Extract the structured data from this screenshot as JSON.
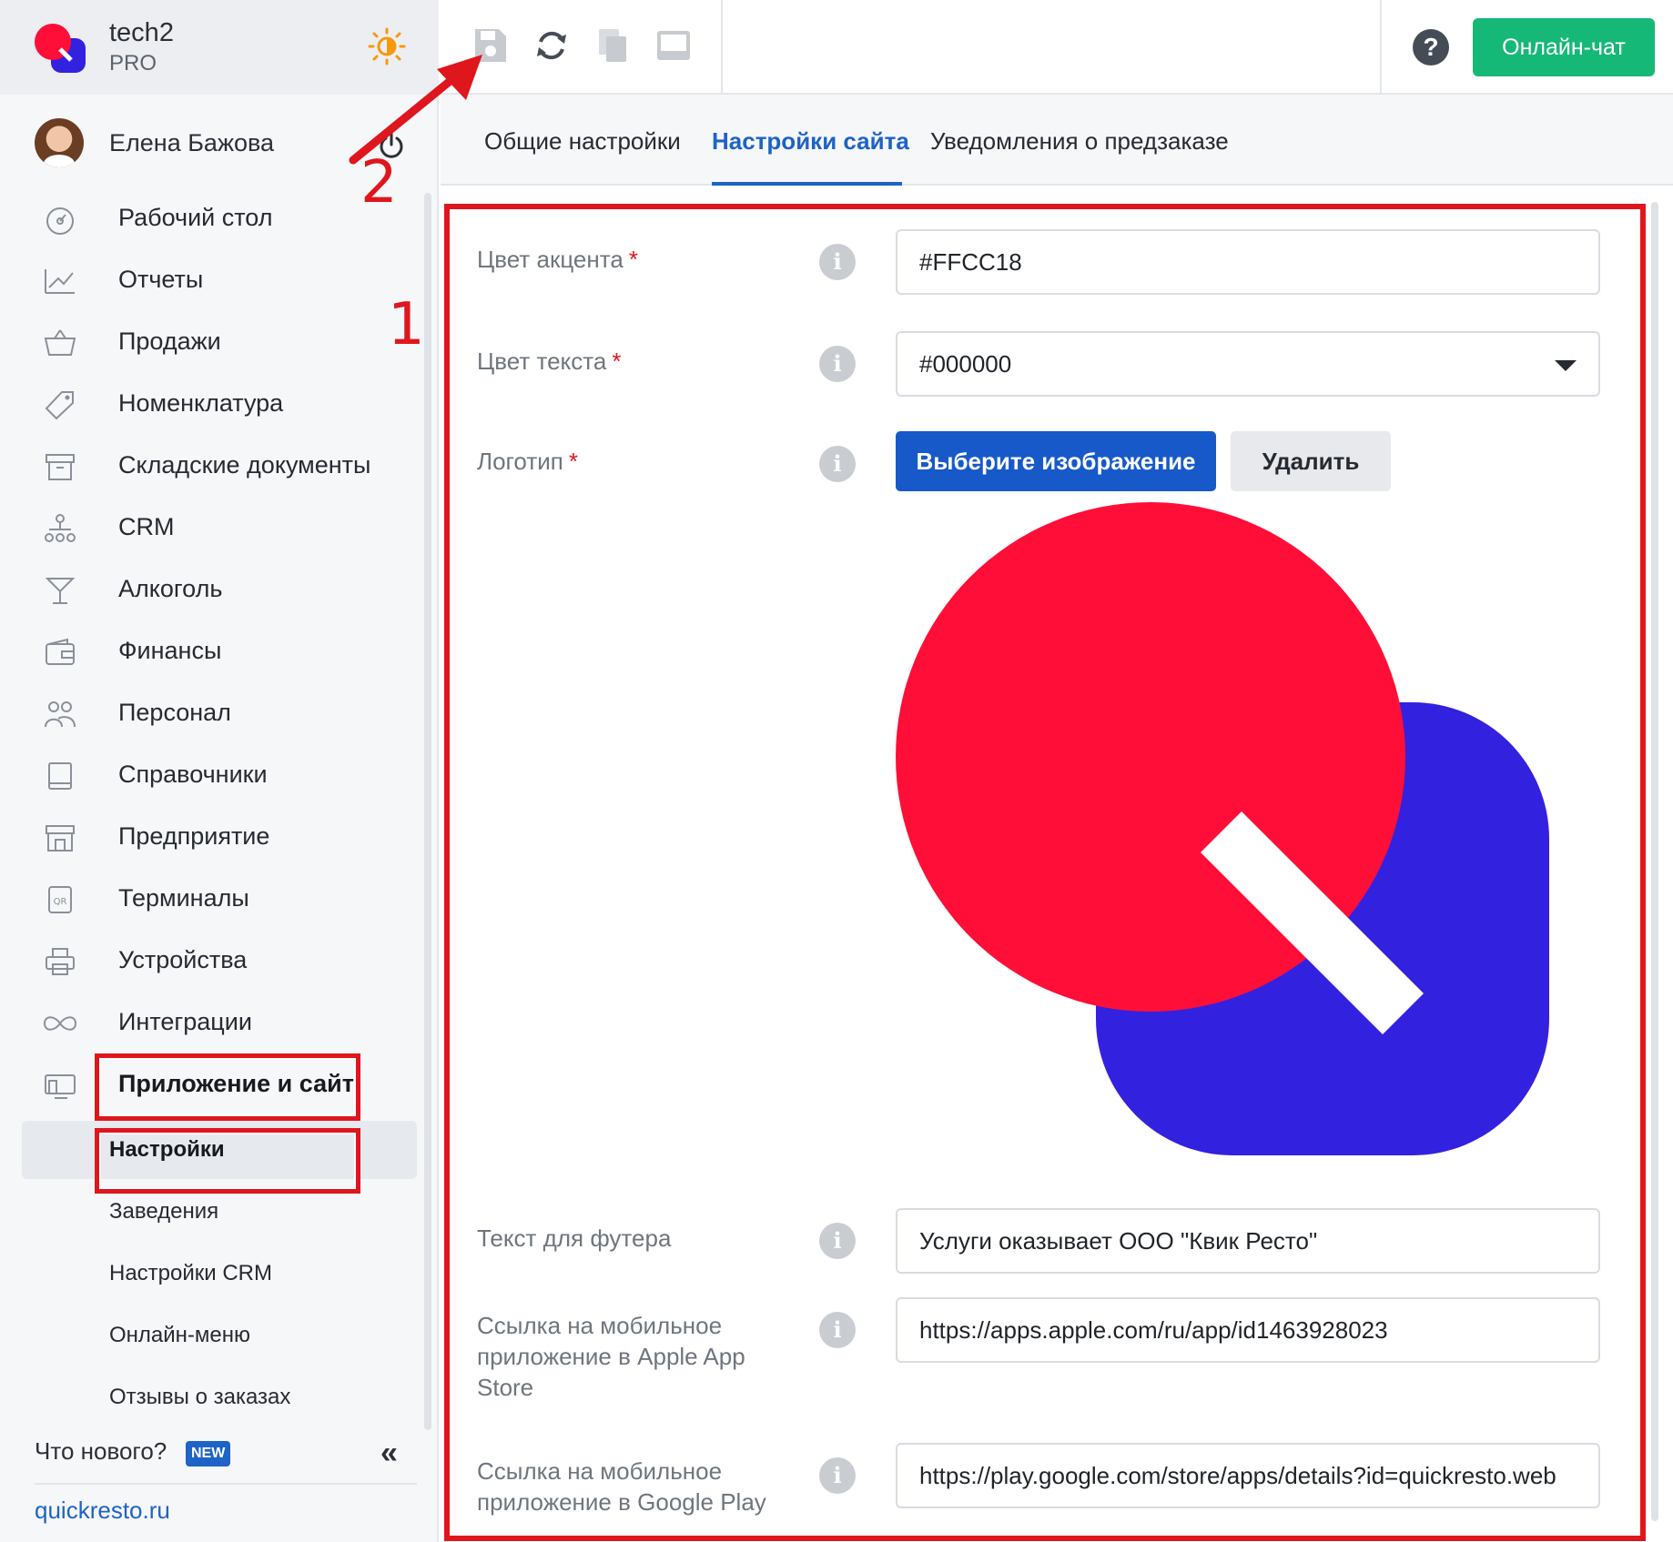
{
  "brand": {
    "name": "tech2",
    "plan": "PRO"
  },
  "user": {
    "name": "Елена Бажова"
  },
  "nav": {
    "items": [
      {
        "label": "Рабочий стол",
        "icon": "dashboard-icon"
      },
      {
        "label": "Отчеты",
        "icon": "chart-icon"
      },
      {
        "label": "Продажи",
        "icon": "basket-icon"
      },
      {
        "label": "Номенклатура",
        "icon": "tag-icon"
      },
      {
        "label": "Складские документы",
        "icon": "archive-icon"
      },
      {
        "label": "CRM",
        "icon": "org-chart-icon"
      },
      {
        "label": "Алкоголь",
        "icon": "cocktail-icon"
      },
      {
        "label": "Финансы",
        "icon": "wallet-icon"
      },
      {
        "label": "Персонал",
        "icon": "people-icon"
      },
      {
        "label": "Справочники",
        "icon": "book-icon"
      },
      {
        "label": "Предприятие",
        "icon": "store-icon"
      },
      {
        "label": "Терминалы",
        "icon": "qr-icon"
      },
      {
        "label": "Устройства",
        "icon": "printer-icon"
      },
      {
        "label": "Интеграции",
        "icon": "infinity-icon"
      },
      {
        "label": "Приложение и сайт",
        "icon": "devices-icon"
      }
    ],
    "sub_items": [
      {
        "label": "Настройки"
      },
      {
        "label": "Заведения"
      },
      {
        "label": "Настройки CRM"
      },
      {
        "label": "Онлайн-меню"
      },
      {
        "label": "Отзывы о заказах"
      }
    ]
  },
  "footer": {
    "whats_new": "Что нового?",
    "new_badge": "NEW",
    "site_link": "quickresto.ru"
  },
  "toolbar": {
    "chat_button": "Онлайн-чат",
    "help": "?"
  },
  "tabs": [
    {
      "label": "Общие настройки"
    },
    {
      "label": "Настройки сайта"
    },
    {
      "label": "Уведомления о предзаказе"
    }
  ],
  "form": {
    "accent_color": {
      "label": "Цвет акцента",
      "value": "#FFCC18"
    },
    "text_color": {
      "label": "Цвет текста",
      "value": "#000000"
    },
    "logo": {
      "label": "Логотип",
      "choose_button": "Выберите изображение",
      "delete_button": "Удалить"
    },
    "footer_text": {
      "label": "Текст для футера",
      "value": "Услуги оказывает ООО \"Квик Ресто\""
    },
    "apple_link": {
      "label": "Ссылка на мобильное приложение в Apple App Store",
      "value": "https://apps.apple.com/ru/app/id1463928023"
    },
    "google_link": {
      "label": "Ссылка на мобильное приложение в Google Play",
      "value": "https://play.google.com/store/apps/details?id=quickresto.web"
    },
    "required_mark": "*",
    "info_glyph": "i"
  },
  "annotations": {
    "marker_1": "1",
    "marker_2": "2"
  },
  "colors": {
    "accent_blue": "#1E63C6",
    "green": "#16B877",
    "annotation_red": "#E0161D",
    "logo_red": "#FF0E38",
    "logo_blue": "#3321E0"
  }
}
